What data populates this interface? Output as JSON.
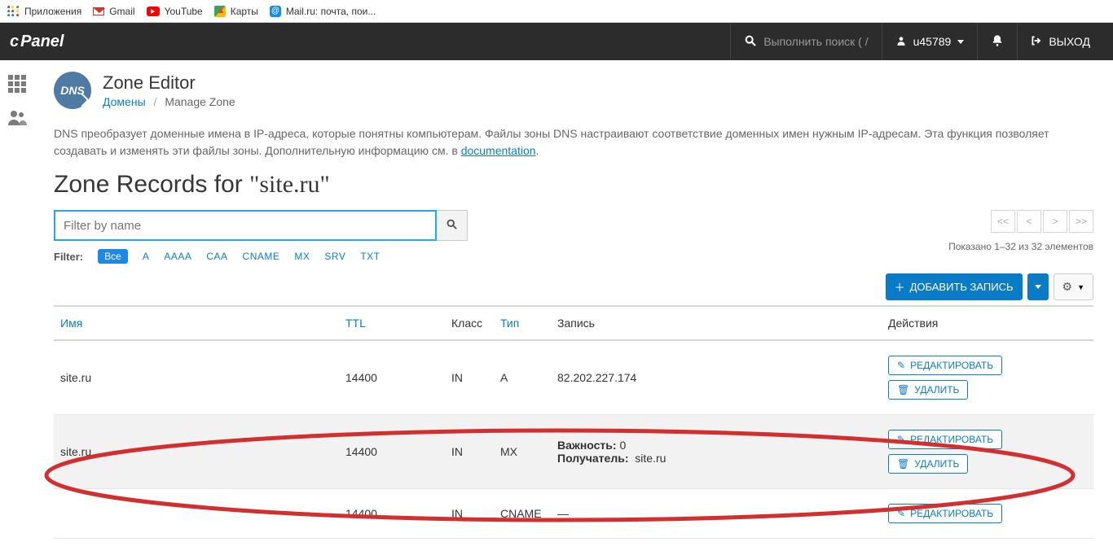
{
  "bookmarks": {
    "apps": "Приложения",
    "gmail": "Gmail",
    "youtube": "YouTube",
    "maps": "Карты",
    "mailru": "Mail.ru: почта, пои..."
  },
  "header": {
    "logo": "cPanel",
    "search_placeholder": "Выполнить поиск ( /",
    "username": "u45789",
    "logout": "ВЫХОД"
  },
  "page": {
    "title": "Zone Editor",
    "breadcrumb_domains": "Домены",
    "breadcrumb_current": "Manage Zone",
    "description_1": "DNS преобразует доменные имена в IP-адреса, которые понятны компьютерам. Файлы зоны DNS настраивают соответствие доменных имен нужным IP-адресам. Эта функция позволяет создавать и изменять эти файлы зоны. Дополнительную информацию см. в ",
    "description_link": "documentation",
    "description_2": ".",
    "zone_heading_prefix": "Zone Records for ",
    "zone_domain": "\"site.ru\""
  },
  "filter": {
    "placeholder": "Filter by name",
    "label": "Filter:",
    "all": "Все",
    "types": [
      "A",
      "AAAA",
      "CAA",
      "CNAME",
      "MX",
      "SRV",
      "TXT"
    ]
  },
  "pagination": {
    "first": "<<",
    "prev": "<",
    "next": ">",
    "last": ">>",
    "shown": "Показано 1–32 из 32 элементов"
  },
  "toolbar": {
    "add_record": "ДОБАВИТЬ ЗАПИСЬ"
  },
  "table": {
    "headers": {
      "name": "Имя",
      "ttl": "TTL",
      "class": "Класс",
      "type": "Тип",
      "record": "Запись",
      "actions": "Действия"
    },
    "action_edit": "РЕДАКТИРОВАТЬ",
    "action_delete": "УДАЛИТЬ",
    "rows": [
      {
        "name": "site.ru",
        "ttl": "14400",
        "class": "IN",
        "type": "A",
        "record_plain": "82.202.227.174"
      },
      {
        "name": "site.ru.",
        "ttl": "14400",
        "class": "IN",
        "type": "MX",
        "record_detail": {
          "priority_label": "Важность:",
          "priority_value": "0",
          "target_label": "Получатель:",
          "target_value": "site.ru"
        }
      },
      {
        "name": "",
        "ttl": "14400",
        "class": "IN",
        "type": "CNAME",
        "record_plain": "—"
      }
    ]
  }
}
